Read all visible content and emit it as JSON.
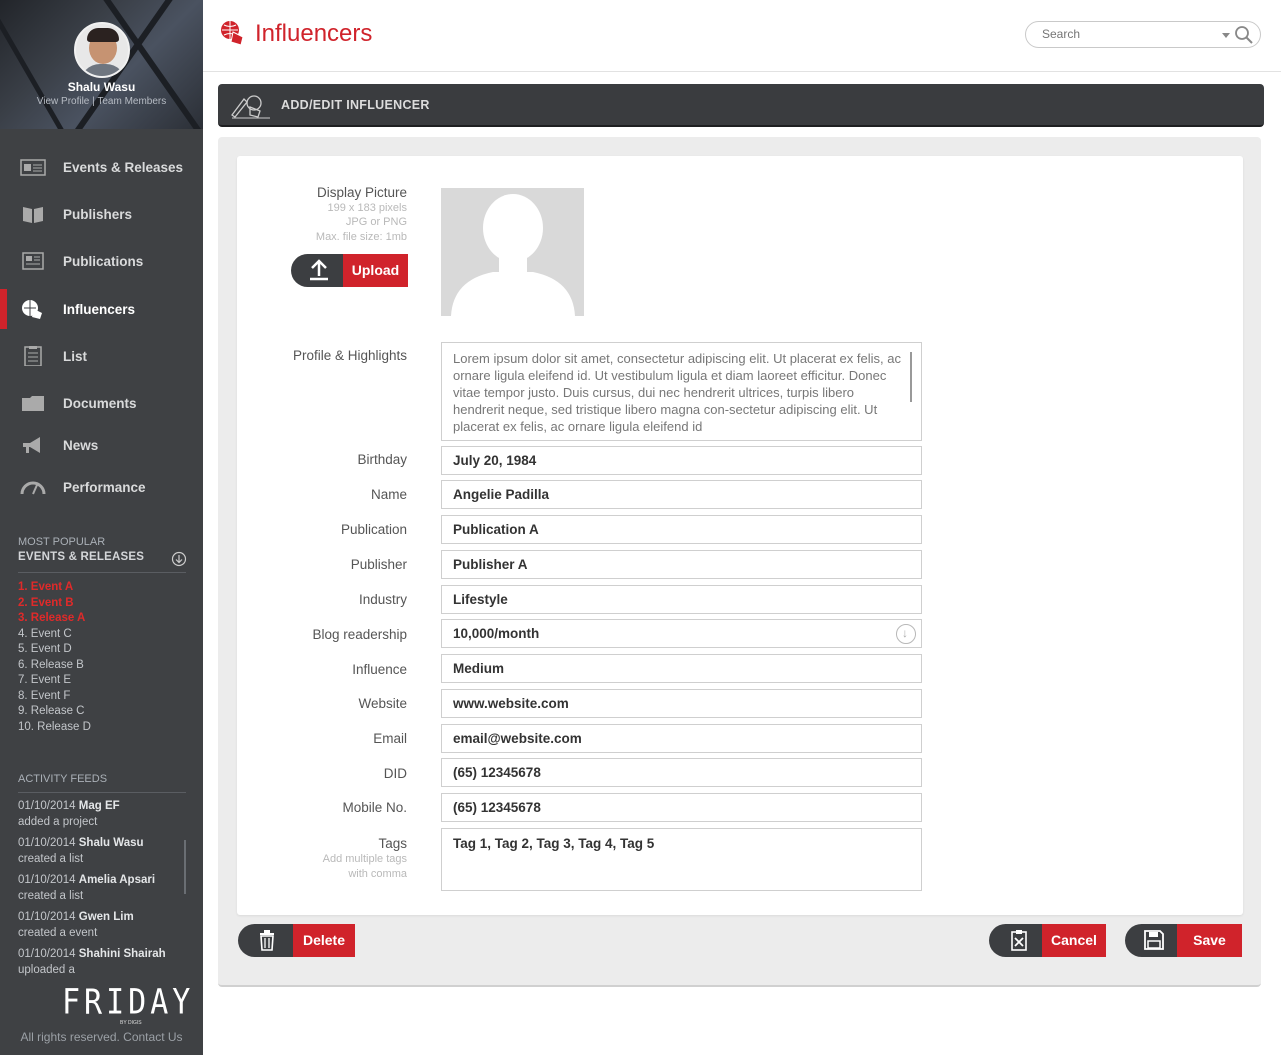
{
  "profile": {
    "name": "Shalu Wasu",
    "links": "View Profile | Team Members"
  },
  "nav": [
    {
      "label": "Events & Releases",
      "icon": "calendar-icon"
    },
    {
      "label": "Publishers",
      "icon": "book-icon"
    },
    {
      "label": "Publications",
      "icon": "newspaper-icon"
    },
    {
      "label": "Influencers",
      "icon": "globe-hand-icon",
      "active": true
    },
    {
      "label": "List",
      "icon": "clipboard-icon"
    },
    {
      "label": "Documents",
      "icon": "folder-icon"
    },
    {
      "label": "News",
      "icon": "megaphone-icon"
    },
    {
      "label": "Performance",
      "icon": "gauge-icon"
    }
  ],
  "popular": {
    "title": "MOST POPULAR",
    "subtitle": "EVENTS & RELEASES",
    "items": [
      "1. Event A",
      "2. Event B",
      "3. Release A",
      "4. Event C",
      "5. Event D",
      "6. Release B",
      "7. Event E",
      "8. Event F",
      "9. Release C",
      "10. Release D"
    ]
  },
  "feeds": {
    "title": "ACTIVITY FEEDS",
    "items": [
      {
        "date": "01/10/2014",
        "who": "Mag EF",
        "what": "added a project"
      },
      {
        "date": "01/10/2014",
        "who": "Shalu Wasu",
        "what": "created a list"
      },
      {
        "date": "01/10/2014",
        "who": "Amelia Apsari",
        "what": "created a list"
      },
      {
        "date": "01/10/2014",
        "who": "Gwen Lim",
        "what": "created a event"
      },
      {
        "date": "01/10/2014",
        "who": "Shahini Shairah",
        "what": "uploaded a"
      }
    ]
  },
  "brand": {
    "logo": "FRIDAY",
    "small": "BY DIGIS",
    "footer": "All rights reserved. Contact Us"
  },
  "header": {
    "title": "Influencers",
    "search_placeholder": "Search"
  },
  "panel": {
    "title": "ADD/EDIT INFLUENCER"
  },
  "form": {
    "display_picture": {
      "label": "Display Picture",
      "hint1": "199 x 183 pixels",
      "hint2": "JPG or PNG",
      "hint3": "Max. file size: 1mb",
      "upload": "Upload"
    },
    "profile_label": "Profile & Highlights",
    "profile_text": "Lorem ipsum dolor sit amet, consectetur adipiscing elit. Ut placerat ex felis, ac ornare ligula eleifend id. Ut vestibulum ligula et diam laoreet efficitur. Donec vitae tempor justo. Duis cursus, dui nec hendrerit ultrices, turpis libero hendrerit neque, sed tristique libero magna con-sectetur adipiscing elit. Ut placerat ex felis, ac ornare ligula eleifend id",
    "fields": [
      {
        "label": "Birthday",
        "value": "July 20, 1984"
      },
      {
        "label": "Name",
        "value": "Angelie Padilla"
      },
      {
        "label": "Publication",
        "value": "Publication A"
      },
      {
        "label": "Publisher",
        "value": "Publisher A"
      },
      {
        "label": "Industry",
        "value": "Lifestyle"
      },
      {
        "label": "Blog readership",
        "value": "10,000/month"
      },
      {
        "label": "Influence",
        "value": "Medium"
      },
      {
        "label": "Website",
        "value": "www.website.com"
      },
      {
        "label": "Email",
        "value": "email@website.com"
      },
      {
        "label": "DID",
        "value": "(65) 12345678"
      },
      {
        "label": "Mobile No.",
        "value": "(65) 12345678"
      }
    ],
    "tags": {
      "label": "Tags",
      "hint1": "Add multiple tags",
      "hint2": "with comma",
      "value": "Tag 1, Tag 2, Tag 3, Tag 4, Tag 5"
    }
  },
  "actions": {
    "delete": "Delete",
    "cancel": "Cancel",
    "save": "Save"
  },
  "colors": {
    "accent": "#d0232b",
    "sidebar": "#3f4144"
  }
}
